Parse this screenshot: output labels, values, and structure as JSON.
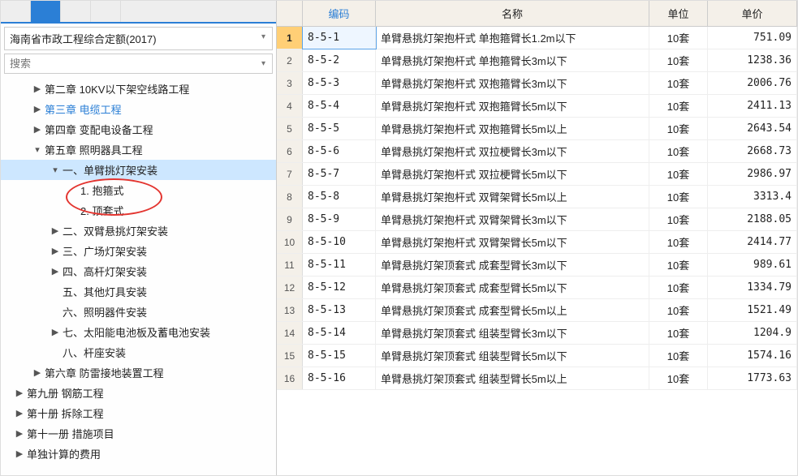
{
  "tabs": [
    {
      "label": ""
    },
    {
      "label": ""
    },
    {
      "label": ""
    },
    {
      "label": ""
    }
  ],
  "category": {
    "selected": "海南省市政工程综合定额(2017)"
  },
  "search": {
    "placeholder": "搜索"
  },
  "tree": [
    {
      "indent": 1,
      "toggle": "▶",
      "label": "第二章 10KV以下架空线路工程",
      "selected": false
    },
    {
      "indent": 1,
      "toggle": "▶",
      "label": "第三章 电缆工程",
      "highlight": true
    },
    {
      "indent": 1,
      "toggle": "▶",
      "label": "第四章 变配电设备工程"
    },
    {
      "indent": 1,
      "toggle": "▾",
      "label": "第五章 照明器具工程"
    },
    {
      "indent": 2,
      "toggle": "▾",
      "label": "一、单臂挑灯架安装",
      "selected": true
    },
    {
      "indent": 3,
      "toggle": "",
      "label": "1. 抱箍式",
      "ellipse": true
    },
    {
      "indent": 3,
      "toggle": "",
      "label": "2. 顶套式"
    },
    {
      "indent": 2,
      "toggle": "▶",
      "label": "二、双臂悬挑灯架安装"
    },
    {
      "indent": 2,
      "toggle": "▶",
      "label": "三、广场灯架安装"
    },
    {
      "indent": 2,
      "toggle": "▶",
      "label": "四、高杆灯架安装"
    },
    {
      "indent": 2,
      "toggle": "",
      "label": "五、其他灯具安装"
    },
    {
      "indent": 2,
      "toggle": "",
      "label": "六、照明器件安装"
    },
    {
      "indent": 2,
      "toggle": "▶",
      "label": "七、太阳能电池板及蓄电池安装"
    },
    {
      "indent": 2,
      "toggle": "",
      "label": "八、杆座安装"
    },
    {
      "indent": 1,
      "toggle": "▶",
      "label": "第六章 防雷接地装置工程"
    },
    {
      "indent": 0,
      "toggle": "▶",
      "label": "第九册 钢筋工程"
    },
    {
      "indent": 0,
      "toggle": "▶",
      "label": "第十册 拆除工程"
    },
    {
      "indent": 0,
      "toggle": "▶",
      "label": "第十一册 措施项目"
    },
    {
      "indent": 0,
      "toggle": "▶",
      "label": "单独计算的费用"
    }
  ],
  "grid": {
    "headers": {
      "code": "编码",
      "name": "名称",
      "unit": "单位",
      "price": "单价"
    },
    "rows": [
      {
        "n": 1,
        "code": "8-5-1",
        "name": "单臂悬挑灯架抱杆式 单抱箍臂长1.2m以下",
        "unit": "10套",
        "price": "751.09"
      },
      {
        "n": 2,
        "code": "8-5-2",
        "name": "单臂悬挑灯架抱杆式 单抱箍臂长3m以下",
        "unit": "10套",
        "price": "1238.36"
      },
      {
        "n": 3,
        "code": "8-5-3",
        "name": "单臂悬挑灯架抱杆式 双抱箍臂长3m以下",
        "unit": "10套",
        "price": "2006.76"
      },
      {
        "n": 4,
        "code": "8-5-4",
        "name": "单臂悬挑灯架抱杆式 双抱箍臂长5m以下",
        "unit": "10套",
        "price": "2411.13"
      },
      {
        "n": 5,
        "code": "8-5-5",
        "name": "单臂悬挑灯架抱杆式 双抱箍臂长5m以上",
        "unit": "10套",
        "price": "2643.54"
      },
      {
        "n": 6,
        "code": "8-5-6",
        "name": "单臂悬挑灯架抱杆式 双拉梗臂长3m以下",
        "unit": "10套",
        "price": "2668.73"
      },
      {
        "n": 7,
        "code": "8-5-7",
        "name": "单臂悬挑灯架抱杆式 双拉梗臂长5m以下",
        "unit": "10套",
        "price": "2986.97"
      },
      {
        "n": 8,
        "code": "8-5-8",
        "name": "单臂悬挑灯架抱杆式 双臂架臂长5m以上",
        "unit": "10套",
        "price": "3313.4"
      },
      {
        "n": 9,
        "code": "8-5-9",
        "name": "单臂悬挑灯架抱杆式 双臂架臂长3m以下",
        "unit": "10套",
        "price": "2188.05"
      },
      {
        "n": 10,
        "code": "8-5-10",
        "name": "单臂悬挑灯架抱杆式 双臂架臂长5m以下",
        "unit": "10套",
        "price": "2414.77"
      },
      {
        "n": 11,
        "code": "8-5-11",
        "name": "单臂悬挑灯架顶套式 成套型臂长3m以下",
        "unit": "10套",
        "price": "989.61"
      },
      {
        "n": 12,
        "code": "8-5-12",
        "name": "单臂悬挑灯架顶套式 成套型臂长5m以下",
        "unit": "10套",
        "price": "1334.79"
      },
      {
        "n": 13,
        "code": "8-5-13",
        "name": "单臂悬挑灯架顶套式 成套型臂长5m以上",
        "unit": "10套",
        "price": "1521.49"
      },
      {
        "n": 14,
        "code": "8-5-14",
        "name": "单臂悬挑灯架顶套式 组装型臂长3m以下",
        "unit": "10套",
        "price": "1204.9"
      },
      {
        "n": 15,
        "code": "8-5-15",
        "name": "单臂悬挑灯架顶套式 组装型臂长5m以下",
        "unit": "10套",
        "price": "1574.16"
      },
      {
        "n": 16,
        "code": "8-5-16",
        "name": "单臂悬挑灯架顶套式 组装型臂长5m以上",
        "unit": "10套",
        "price": "1773.63"
      }
    ],
    "selected_row": 1
  }
}
